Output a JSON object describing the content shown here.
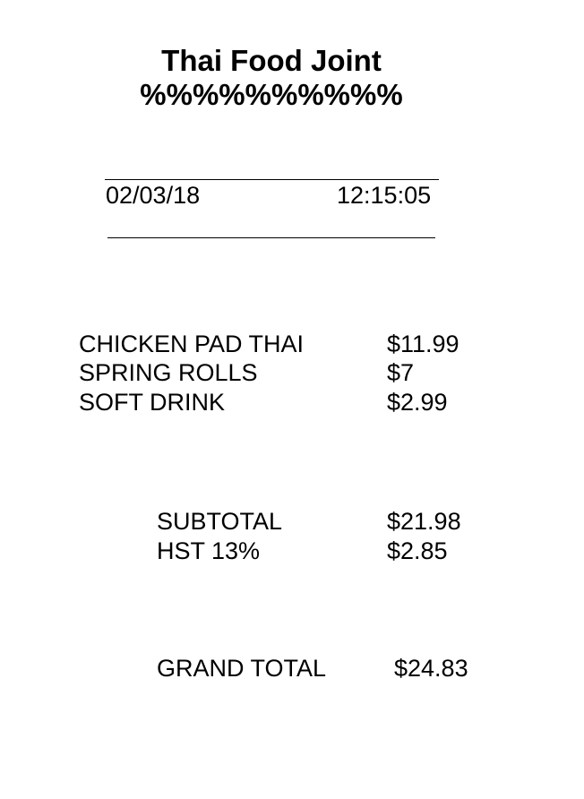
{
  "header": {
    "store_name": "Thai Food Joint",
    "decoration": "%%%%%%%%%%"
  },
  "meta": {
    "date": "02/03/18",
    "time": "12:15:05"
  },
  "items": [
    {
      "name": "CHICKEN PAD THAI",
      "price": "$11.99"
    },
    {
      "name": "SPRING ROLLS",
      "price": "$7"
    },
    {
      "name": "SOFT DRINK",
      "price": "$2.99"
    }
  ],
  "summary": [
    {
      "label": "SUBTOTAL",
      "value": "$21.98"
    },
    {
      "label": "HST 13%",
      "value": "$2.85"
    }
  ],
  "grand_total": {
    "label": "GRAND TOTAL",
    "value": "$24.83"
  },
  "colors": {
    "text": "#000000",
    "background": "#ffffff"
  }
}
